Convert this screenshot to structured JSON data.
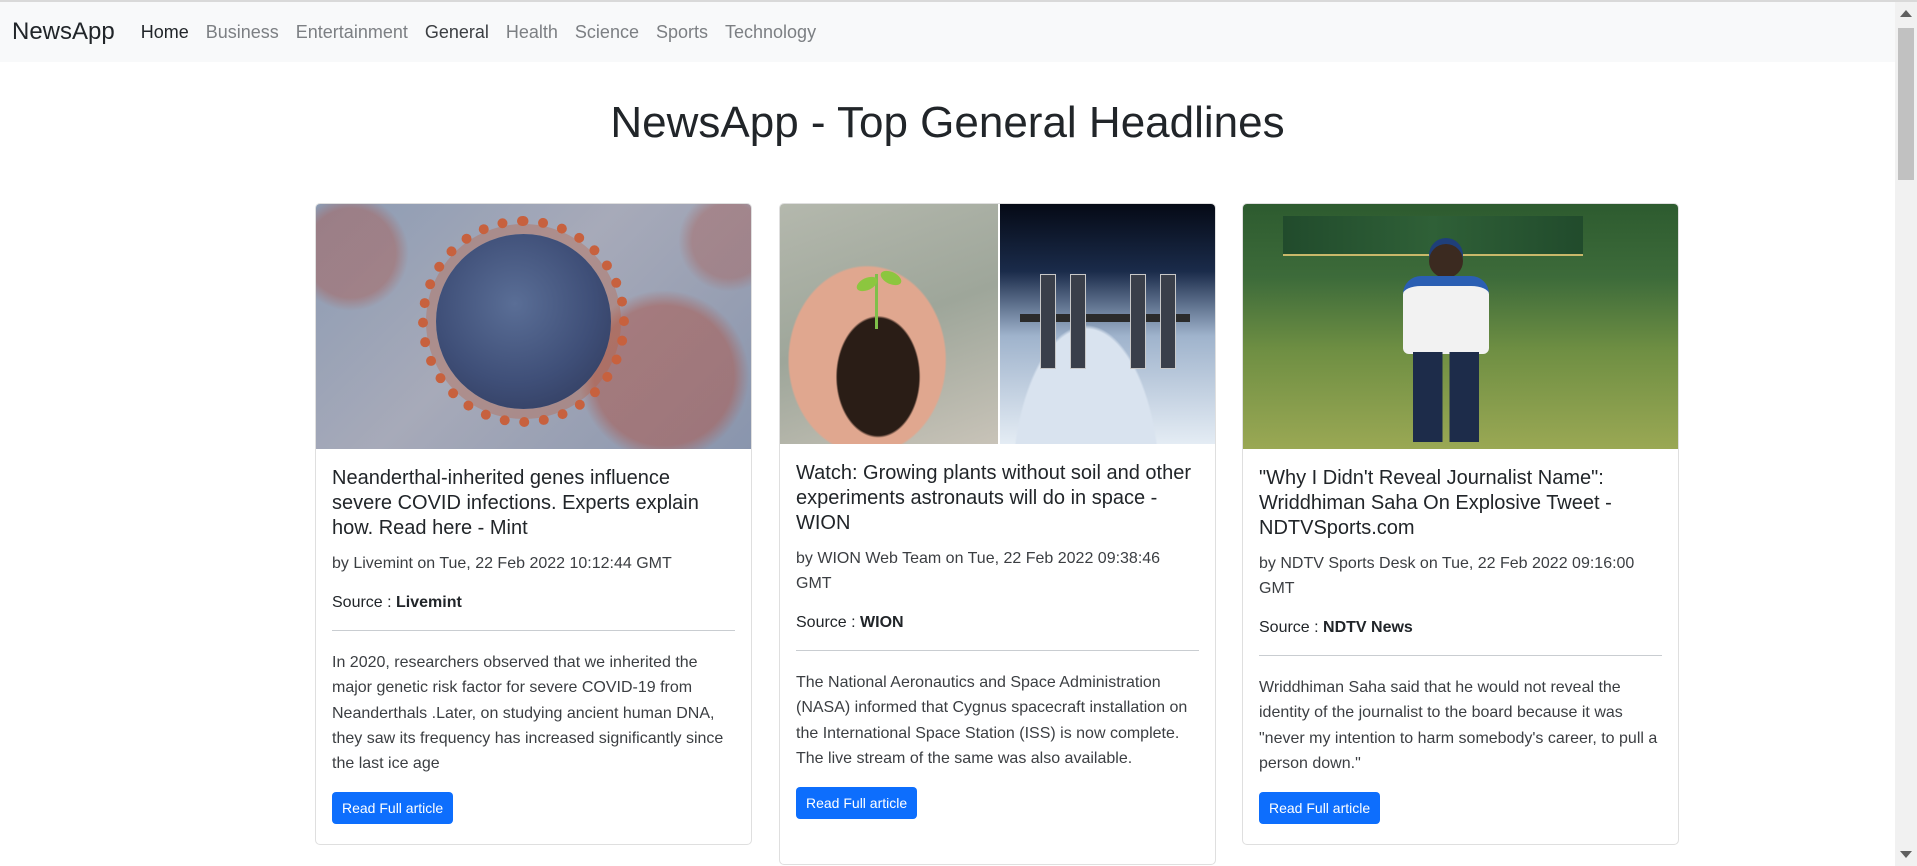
{
  "navbar": {
    "brand": "NewsApp",
    "links": [
      {
        "label": "Home",
        "state": "active"
      },
      {
        "label": "Business",
        "state": "default"
      },
      {
        "label": "Entertainment",
        "state": "default"
      },
      {
        "label": "General",
        "state": "current"
      },
      {
        "label": "Health",
        "state": "default"
      },
      {
        "label": "Science",
        "state": "default"
      },
      {
        "label": "Sports",
        "state": "default"
      },
      {
        "label": "Technology",
        "state": "default"
      }
    ]
  },
  "page": {
    "title": "NewsApp - Top General Headlines"
  },
  "articles": [
    {
      "title": "Neanderthal-inherited genes influence severe COVID infections. Experts explain how. Read here - Mint",
      "meta": "by Livemint on Tue, 22 Feb 2022 10:12:44 GMT",
      "source_label": "Source : ",
      "source": "Livemint",
      "description": "In 2020, researchers observed that we inherited the major genetic risk factor for severe COVID-19 from Neanderthals .Later, on studying ancient human DNA, they saw its frequency has increased significantly since the last ice age",
      "button_label": "Read Full article",
      "image": "coronavirus-illustration"
    },
    {
      "title": "Watch: Growing plants without soil and other experiments astronauts will do in space - WION",
      "meta": "by WION Web Team on Tue, 22 Feb 2022 09:38:46 GMT",
      "source_label": "Source : ",
      "source": "WION",
      "description": "The National Aeronautics and Space Administration (NASA) informed that Cygnus spacecraft installation on the International Space Station (ISS) is now complete. The live stream of the same was also available.",
      "button_label": "Read Full article",
      "image": "plant-and-space-station"
    },
    {
      "title": "\"Why I Didn't Reveal Journalist Name\": Wriddhiman Saha On Explosive Tweet - NDTVSports.com",
      "meta": "by NDTV Sports Desk on Tue, 22 Feb 2022 09:16:00 GMT",
      "source_label": "Source : ",
      "source": "NDTV News",
      "description": "Wriddhiman Saha said that he would not reveal the identity of the journalist to the board because it was \"never my intention to harm somebody's career, to pull a person down.\"",
      "button_label": "Read Full article",
      "image": "cricketer-photo"
    }
  ],
  "colors": {
    "navbar_bg": "#f8f9fa",
    "button_primary": "#0d6efd",
    "text_dark": "#212529",
    "link_muted": "#7c7f83"
  }
}
